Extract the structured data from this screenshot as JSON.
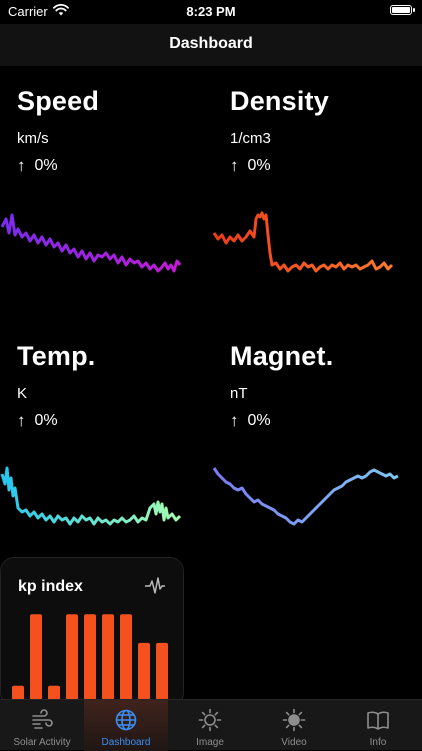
{
  "status_bar": {
    "carrier": "Carrier",
    "time": "8:23 PM"
  },
  "nav": {
    "title": "Dashboard"
  },
  "metrics": [
    {
      "title": "Speed",
      "unit": "km/s",
      "change": "0%"
    },
    {
      "title": "Density",
      "unit": "1/cm3",
      "change": "0%"
    },
    {
      "title": "Temp.",
      "unit": "K",
      "change": "0%"
    },
    {
      "title": "Magnet.",
      "unit": "nT",
      "change": "0%"
    }
  ],
  "kp": {
    "title": "kp index",
    "values": [
      1,
      6,
      1,
      6,
      6,
      6,
      6,
      4,
      4
    ],
    "max": 7,
    "bar_color": "#f4511e",
    "icon": "waveform-icon"
  },
  "tabs": [
    {
      "label": "Solar Activity",
      "icon": "wind-icon"
    },
    {
      "label": "Dashboard",
      "icon": "globe-icon",
      "active": true
    },
    {
      "label": "Image",
      "icon": "sun-icon"
    },
    {
      "label": "Video",
      "icon": "sun-filled-icon"
    },
    {
      "label": "Info",
      "icon": "book-icon"
    }
  ],
  "colors": {
    "active_tab": "#3b8df0",
    "inactive_tab": "#8e8e8e",
    "speed_gradient": [
      "#7a2cf0",
      "#c61ad8"
    ],
    "density_gradient": [
      "#ee3a1c",
      "#ff7a2a"
    ],
    "temp_gradient": [
      "#26c6f0",
      "#a6ffb0"
    ],
    "magnet_gradient": [
      "#7a7cf2",
      "#7ec6f6"
    ]
  }
}
